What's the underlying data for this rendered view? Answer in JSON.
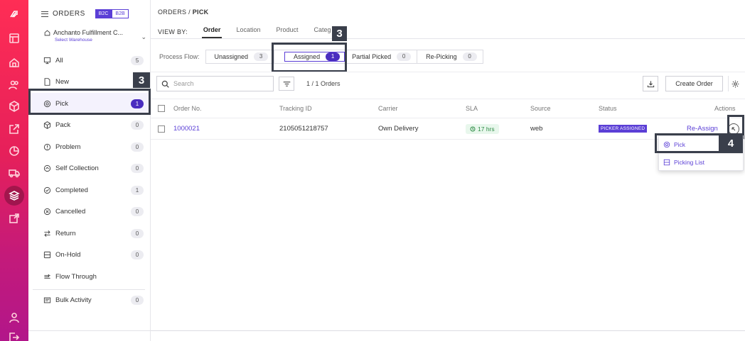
{
  "sidebar": {
    "title": "ORDERS",
    "toggle": {
      "b2c": "B2C",
      "b2b": "B2B"
    },
    "warehouse": {
      "name": "Anchanto Fulfillment C...",
      "sub": "Select Warehouse"
    },
    "items": [
      {
        "label": "All",
        "count": "5",
        "icon": "monitor-icon"
      },
      {
        "label": "New",
        "count": "",
        "icon": "document-icon"
      },
      {
        "label": "Pick",
        "count": "1",
        "icon": "pick-icon",
        "active": true
      },
      {
        "label": "Pack",
        "count": "0",
        "icon": "box-icon"
      },
      {
        "label": "Problem",
        "count": "0",
        "icon": "alert-icon"
      },
      {
        "label": "Self Collection",
        "count": "0",
        "icon": "collection-icon"
      },
      {
        "label": "Completed",
        "count": "1",
        "icon": "check-circle-icon"
      },
      {
        "label": "Cancelled",
        "count": "0",
        "icon": "x-circle-icon"
      },
      {
        "label": "Return",
        "count": "0",
        "icon": "return-icon"
      },
      {
        "label": "On-Hold",
        "count": "0",
        "icon": "hold-icon"
      },
      {
        "label": "Flow Through",
        "count": "",
        "icon": "flow-icon"
      },
      {
        "label": "Bulk Activity",
        "count": "0",
        "icon": "bulk-icon"
      }
    ]
  },
  "main": {
    "breadcrumb": {
      "root": "ORDERS",
      "sep": "/",
      "current": "PICK"
    },
    "viewby": {
      "label": "VIEW BY:",
      "tabs": [
        "Order",
        "Location",
        "Product",
        "Categ"
      ]
    },
    "process_flow": {
      "label": "Process Flow:",
      "steps": [
        {
          "label": "Unassigned",
          "count": "3"
        },
        {
          "label": "Assigned",
          "count": "1",
          "active": true
        },
        {
          "label": "Partial Picked",
          "count": "0"
        },
        {
          "label": "Re-Picking",
          "count": "0"
        }
      ]
    },
    "search": {
      "placeholder": "Search"
    },
    "order_count": "1 / 1 Orders",
    "create_order": "Create Order",
    "table": {
      "headers": [
        "Order No.",
        "Tracking ID",
        "Carrier",
        "SLA",
        "Source",
        "Status",
        "Actions"
      ],
      "rows": [
        {
          "order_no": "1000021",
          "tracking_id": "2105051218757",
          "carrier": "Own Delivery",
          "sla": "17 hrs",
          "source": "web",
          "status": "PICKER ASSIGNED",
          "action": "Re-Assign"
        }
      ]
    },
    "action_menu": [
      {
        "label": "Pick",
        "icon": "pick-icon"
      },
      {
        "label": "Picking List",
        "icon": "list-icon"
      }
    ]
  },
  "callouts": {
    "sidebar": "3",
    "process": "3",
    "menu": "4"
  },
  "colors": {
    "accent": "#5b3fd6",
    "rail": "#e6205a",
    "callout": "#3a3f4b"
  }
}
